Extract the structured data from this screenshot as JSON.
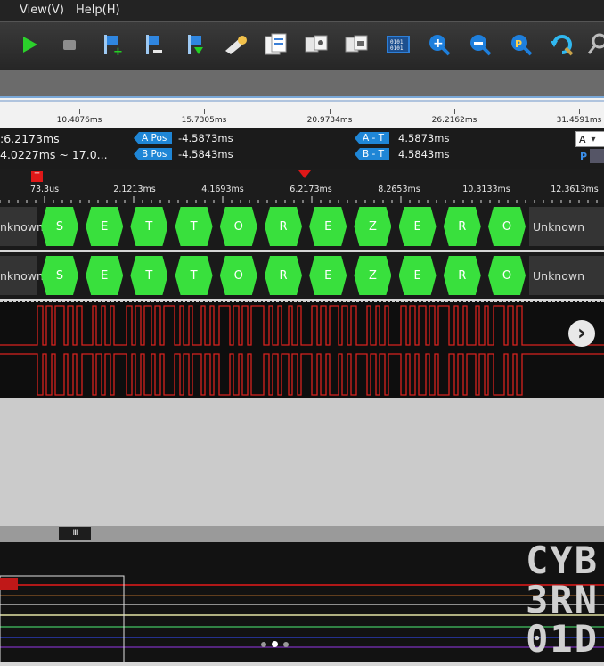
{
  "menu": {
    "items": [
      "View(V)",
      "Help(H)"
    ]
  },
  "toolbar": {
    "icons": [
      "play-icon",
      "stop-icon",
      "add-channel-icon",
      "remove-channel-icon",
      "download-channel-icon",
      "flashlight-icon",
      "documents-icon",
      "copy-icon",
      "paste-icon",
      "binary-display-icon",
      "zoom-in-icon",
      "zoom-out-icon",
      "zoom-fit-icon",
      "refresh-icon",
      "search-icon"
    ]
  },
  "overview": {
    "ticks": [
      "10.4876ms",
      "15.7305ms",
      "20.9734ms",
      "26.2162ms",
      "31.4591ms"
    ]
  },
  "info": {
    "time_current": ":6.2173ms",
    "time_range": "4.0227ms ~ 17.0...",
    "a_pos_label": "A Pos",
    "a_pos_value": "-4.5873ms",
    "b_pos_label": "B Pos",
    "b_pos_value": "-4.5843ms",
    "a_t_label": "A - T",
    "a_t_value": "4.5873ms",
    "b_t_label": "B - T",
    "b_t_value": "4.5843ms",
    "channel_select": "A",
    "p_label": "P"
  },
  "ruler": {
    "trigger_marker": "T",
    "ticks": [
      "73.3us",
      "2.1213ms",
      "4.1693ms",
      "6.2173ms",
      "8.2653ms",
      "10.3133ms",
      "12.3613ms"
    ]
  },
  "decode": {
    "left_label": "nknown",
    "right_label": "Unknown",
    "chars": [
      "S",
      "E",
      "T",
      "T",
      "O",
      "R",
      "E",
      "Z",
      "E",
      "R",
      "O"
    ]
  },
  "nav": {
    "next_arrow": "›"
  },
  "scroll": {
    "handle_glyph": "III"
  },
  "logo": {
    "line1": "CYB",
    "line2": "3RN",
    "line3": "01D"
  },
  "colors": {
    "decode_green": "#39e03d",
    "signal_red": "#d8231f",
    "tag_blue": "#1f86d6"
  }
}
